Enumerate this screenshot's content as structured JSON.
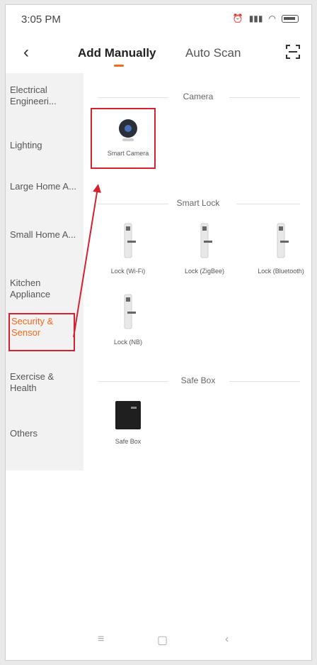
{
  "status": {
    "time": "3:05 PM",
    "icons": [
      "alarm-icon",
      "signal-icon",
      "wifi-icon",
      "battery-icon"
    ]
  },
  "header": {
    "tabs": [
      "Add Manually",
      "Auto Scan"
    ],
    "active_tab": "Add Manually"
  },
  "sidebar": {
    "items": [
      {
        "label": "Electrical Engineeri..."
      },
      {
        "label": "Lighting"
      },
      {
        "label": "Large Home A..."
      },
      {
        "label": "Small Home A..."
      },
      {
        "label": "Kitchen Appliance"
      },
      {
        "label": "Security & Sensor"
      },
      {
        "label": "Exercise & Health"
      },
      {
        "label": "Others"
      }
    ],
    "active_item": "Security & Sensor"
  },
  "sections": {
    "camera": {
      "title": "Camera",
      "devices": [
        "Smart Camera"
      ]
    },
    "smart_lock": {
      "title": "Smart Lock",
      "devices": [
        "Lock (Wi-Fi)",
        "Lock (ZigBee)",
        "Lock (Bluetooth)",
        "Lock (NB)"
      ]
    },
    "safe_box": {
      "title": "Safe Box",
      "devices": [
        "Safe Box"
      ]
    }
  },
  "colors": {
    "accent": "#f26b1d",
    "annotation": "#d4202f"
  },
  "nav": {
    "icons": [
      "menu-icon",
      "home-icon",
      "back-icon"
    ]
  }
}
